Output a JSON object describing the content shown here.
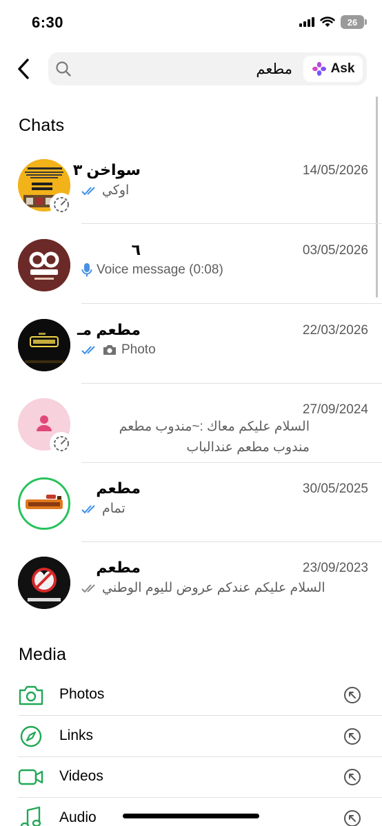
{
  "status_bar": {
    "time": "6:30",
    "battery": "26"
  },
  "search": {
    "value": "مطعم",
    "ask_label": "Ask"
  },
  "sections": {
    "chats": "Chats",
    "media": "Media"
  },
  "chats": [
    {
      "name": "سواخن ٣",
      "date": "14/05/2026",
      "preview": "اوكي",
      "ticks": "read"
    },
    {
      "name": "٦",
      "date": "03/05/2026",
      "preview": "Voice message (0:08)",
      "type": "voice"
    },
    {
      "name": "مطعم مـ",
      "date": "22/03/2026",
      "preview": "Photo",
      "ticks": "read",
      "type": "photo"
    },
    {
      "name": "",
      "date": "27/09/2024",
      "preview_line1": "السلام عليكم معاك :~مندوب مطعم",
      "preview_line2": "مندوب مطعم عندالباب"
    },
    {
      "name": "مطعم",
      "date": "30/05/2025",
      "preview": "تمام",
      "ticks": "read"
    },
    {
      "name": "مطعم",
      "date": "23/09/2023",
      "preview": "السلام عليكم عندكم عروض لليوم الوطني",
      "ticks": "delivered"
    }
  ],
  "media_items": [
    {
      "label": "Photos",
      "icon": "camera-icon"
    },
    {
      "label": "Links",
      "icon": "compass-icon"
    },
    {
      "label": "Videos",
      "icon": "video-icon"
    },
    {
      "label": "Audio",
      "icon": "music-note-icon"
    }
  ],
  "colors": {
    "accent": "#1fa855",
    "read_ticks": "#3c8ee6",
    "voice_mic": "#4a90e2"
  }
}
